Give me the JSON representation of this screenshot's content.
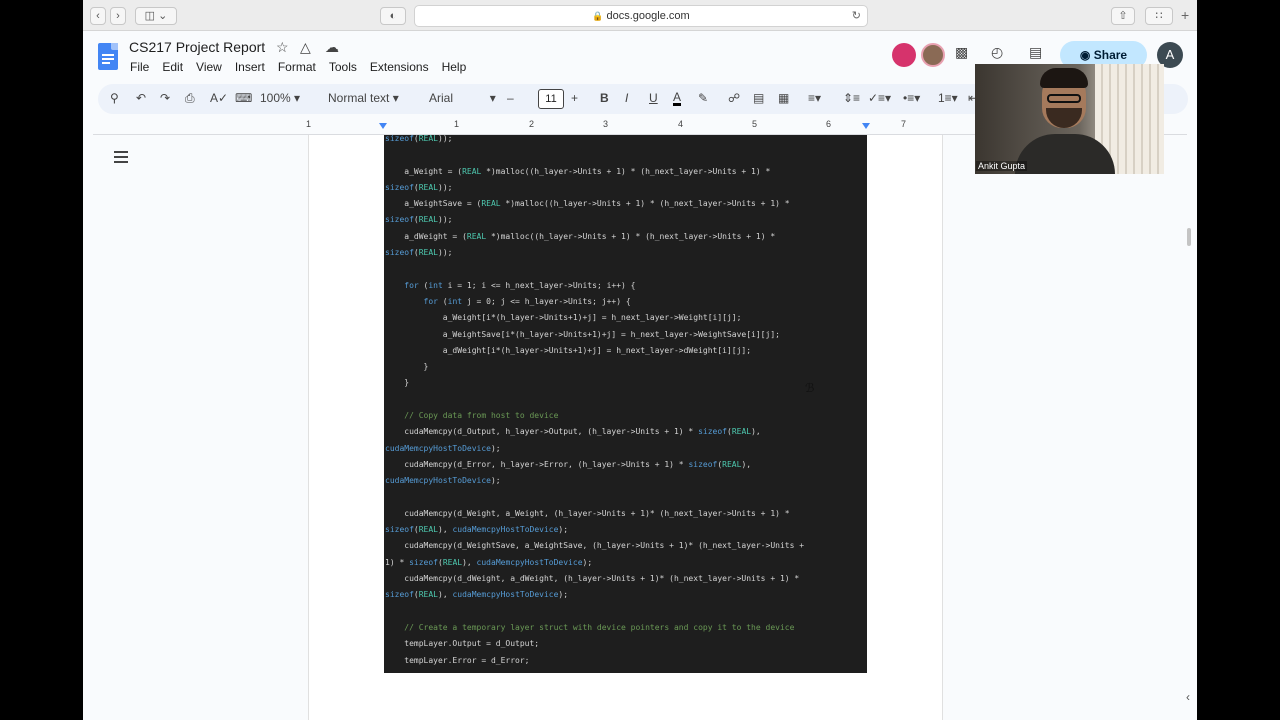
{
  "browser": {
    "url": "docs.google.com"
  },
  "doc": {
    "title": "CS217 Project Report",
    "menu": [
      "File",
      "Edit",
      "View",
      "Insert",
      "Format",
      "Tools",
      "Extensions",
      "Help"
    ],
    "share_label": "Share",
    "account_initial": "A"
  },
  "toolbar": {
    "zoom": "100%",
    "style": "Normal text",
    "font": "Arial",
    "font_size": "11"
  },
  "ruler": {
    "numbers": [
      "1",
      "1",
      "2",
      "3",
      "4",
      "5",
      "6",
      "7"
    ]
  },
  "webcam": {
    "name": "Ankit Gupta"
  },
  "code_lines": [
    [
      {
        "c": "kw",
        "t": "sizeof"
      },
      {
        "t": "("
      },
      {
        "c": "ty",
        "t": "REAL"
      },
      {
        "t": "));"
      }
    ],
    [],
    [
      {
        "t": "    a_Weight = ("
      },
      {
        "c": "ty",
        "t": "REAL"
      },
      {
        "t": " *)malloc((h_layer->Units + 1) * (h_next_layer->Units + 1) *"
      }
    ],
    [
      {
        "c": "kw",
        "t": "sizeof"
      },
      {
        "t": "("
      },
      {
        "c": "ty",
        "t": "REAL"
      },
      {
        "t": "));"
      }
    ],
    [
      {
        "t": "    a_WeightSave = ("
      },
      {
        "c": "ty",
        "t": "REAL"
      },
      {
        "t": " *)malloc((h_layer->Units + 1) * (h_next_layer->Units + 1) *"
      }
    ],
    [
      {
        "c": "kw",
        "t": "sizeof"
      },
      {
        "t": "("
      },
      {
        "c": "ty",
        "t": "REAL"
      },
      {
        "t": "));"
      }
    ],
    [
      {
        "t": "    a_dWeight = ("
      },
      {
        "c": "ty",
        "t": "REAL"
      },
      {
        "t": " *)malloc((h_layer->Units + 1) * (h_next_layer->Units + 1) *"
      }
    ],
    [
      {
        "c": "kw",
        "t": "sizeof"
      },
      {
        "t": "("
      },
      {
        "c": "ty",
        "t": "REAL"
      },
      {
        "t": "));"
      }
    ],
    [],
    [
      {
        "t": "    "
      },
      {
        "c": "kw",
        "t": "for"
      },
      {
        "t": " ("
      },
      {
        "c": "kw",
        "t": "int"
      },
      {
        "t": " i = 1; i <= h_next_layer->Units; i++) {"
      }
    ],
    [
      {
        "t": "        "
      },
      {
        "c": "kw",
        "t": "for"
      },
      {
        "t": " ("
      },
      {
        "c": "kw",
        "t": "int"
      },
      {
        "t": " j = 0; j <= h_layer->Units; j++) {"
      }
    ],
    [
      {
        "t": "            a_Weight[i*(h_layer->Units+1)+j] = h_next_layer->Weight[i][j];"
      }
    ],
    [
      {
        "t": "            a_WeightSave[i*(h_layer->Units+1)+j] = h_next_layer->WeightSave[i][j];"
      }
    ],
    [
      {
        "t": "            a_dWeight[i*(h_layer->Units+1)+j] = h_next_layer->dWeight[i][j];"
      }
    ],
    [
      {
        "t": "        }"
      }
    ],
    [
      {
        "t": "    }"
      }
    ],
    [],
    [
      {
        "c": "cm",
        "t": "    // Copy data from host to device"
      }
    ],
    [
      {
        "t": "    cudaMemcpy(d_Output, h_layer->Output, (h_layer->Units + 1) * "
      },
      {
        "c": "kw",
        "t": "sizeof"
      },
      {
        "t": "("
      },
      {
        "c": "ty",
        "t": "REAL"
      },
      {
        "t": "),"
      }
    ],
    [
      {
        "c": "kw",
        "t": "cudaMemcpyHostToDevice"
      },
      {
        "t": ");"
      }
    ],
    [
      {
        "t": "    cudaMemcpy(d_Error, h_layer->Error, (h_layer->Units + 1) * "
      },
      {
        "c": "kw",
        "t": "sizeof"
      },
      {
        "t": "("
      },
      {
        "c": "ty",
        "t": "REAL"
      },
      {
        "t": "),"
      }
    ],
    [
      {
        "c": "kw",
        "t": "cudaMemcpyHostToDevice"
      },
      {
        "t": ");"
      }
    ],
    [],
    [
      {
        "t": "    cudaMemcpy(d_Weight, a_Weight, (h_layer->Units + 1)* (h_next_layer->Units + 1) *"
      }
    ],
    [
      {
        "c": "kw",
        "t": "sizeof"
      },
      {
        "t": "("
      },
      {
        "c": "ty",
        "t": "REAL"
      },
      {
        "t": "), "
      },
      {
        "c": "kw",
        "t": "cudaMemcpyHostToDevice"
      },
      {
        "t": ");"
      }
    ],
    [
      {
        "t": "    cudaMemcpy(d_WeightSave, a_WeightSave, (h_layer->Units + 1)* (h_next_layer->Units +"
      }
    ],
    [
      {
        "t": "1) * "
      },
      {
        "c": "kw",
        "t": "sizeof"
      },
      {
        "t": "("
      },
      {
        "c": "ty",
        "t": "REAL"
      },
      {
        "t": "), "
      },
      {
        "c": "kw",
        "t": "cudaMemcpyHostToDevice"
      },
      {
        "t": ");"
      }
    ],
    [
      {
        "t": "    cudaMemcpy(d_dWeight, a_dWeight, (h_layer->Units + 1)* (h_next_layer->Units + 1) *"
      }
    ],
    [
      {
        "c": "kw",
        "t": "sizeof"
      },
      {
        "t": "("
      },
      {
        "c": "ty",
        "t": "REAL"
      },
      {
        "t": "), "
      },
      {
        "c": "kw",
        "t": "cudaMemcpyHostToDevice"
      },
      {
        "t": ");"
      }
    ],
    [],
    [
      {
        "c": "cm",
        "t": "    // Create a temporary layer struct with device pointers and copy it to the device"
      }
    ],
    [
      {
        "t": "    tempLayer.Output = d_Output;"
      }
    ],
    [
      {
        "t": "    tempLayer.Error = d_Error;"
      }
    ]
  ]
}
